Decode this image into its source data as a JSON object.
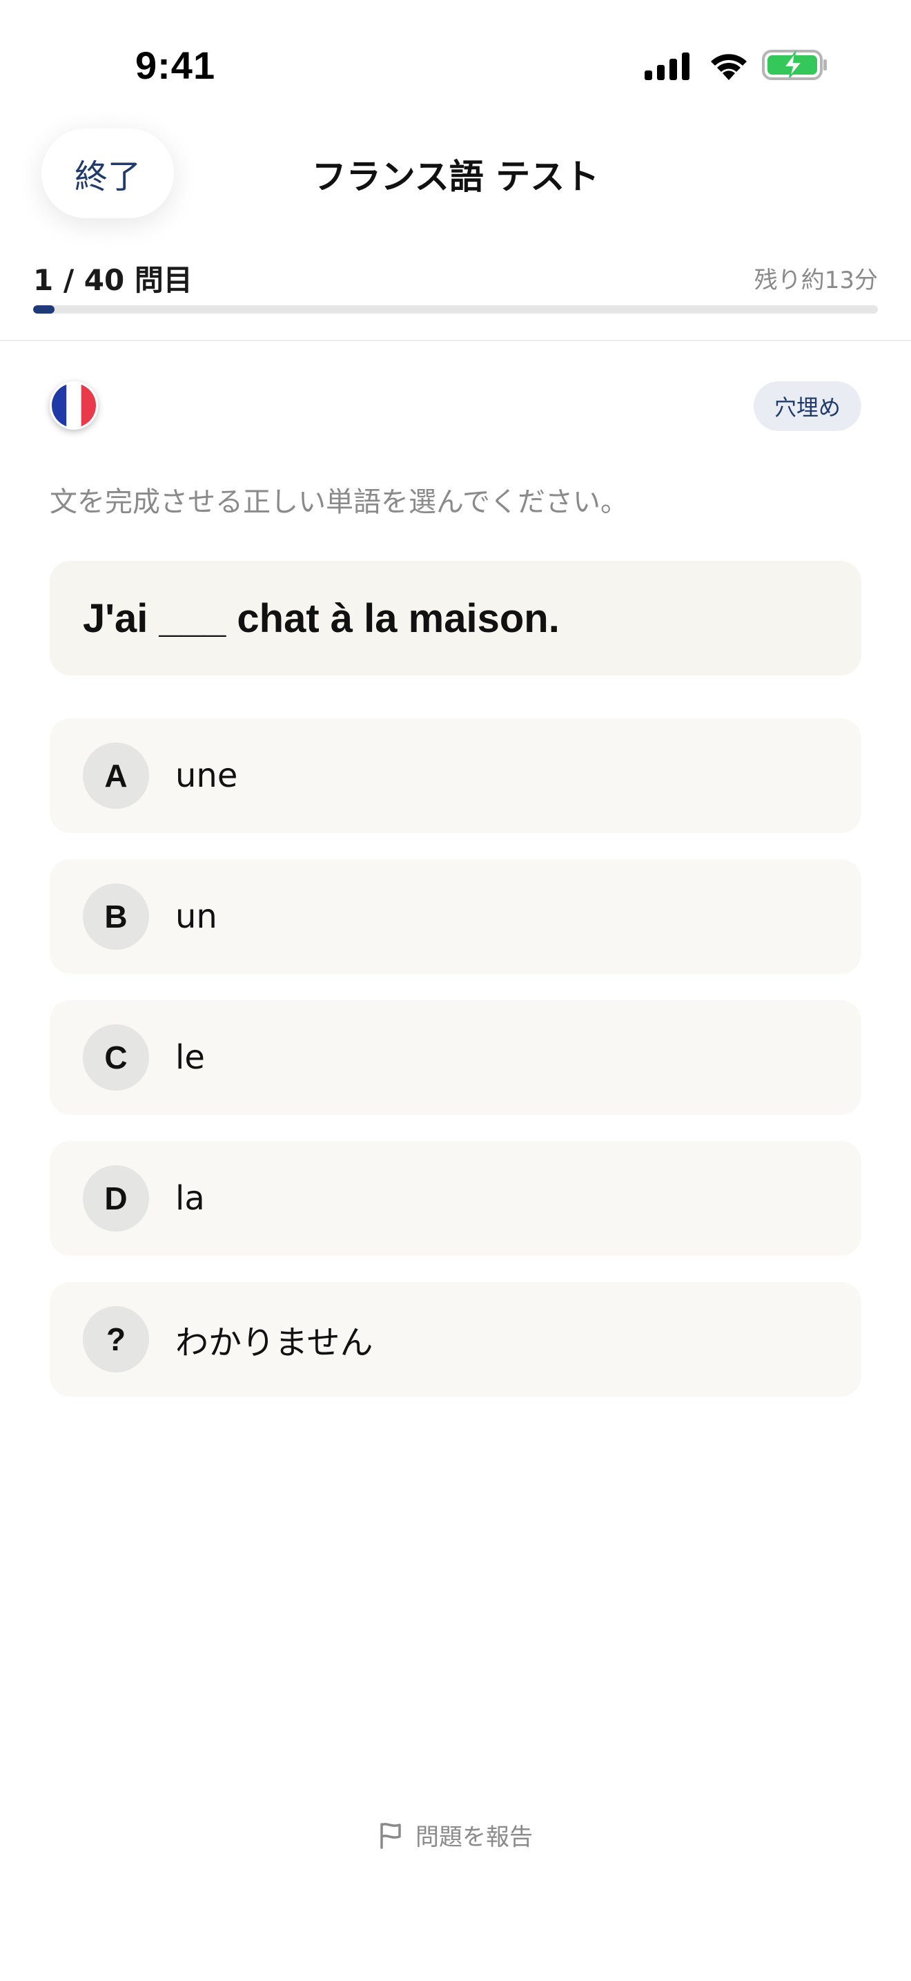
{
  "status_bar": {
    "time": "9:41",
    "icons": [
      "signal-icon",
      "wifi-icon",
      "battery-charging-icon"
    ],
    "battery_color": "#34c759"
  },
  "header": {
    "quit_label": "終了",
    "title": "フランス語 テスト"
  },
  "progress": {
    "count_label": "1 / 40 問目",
    "remaining_label": "残り約13分",
    "current": 1,
    "total": 40,
    "fill_color": "#1e3a78"
  },
  "question": {
    "language_flag": "france-flag-icon",
    "type_badge": "穴埋め",
    "instruction": "文を完成させる正しい単語を選んでください。",
    "sentence": "J'ai ___ chat à la maison."
  },
  "options": [
    {
      "letter": "A",
      "text": "une"
    },
    {
      "letter": "B",
      "text": "un"
    },
    {
      "letter": "C",
      "text": "le"
    },
    {
      "letter": "D",
      "text": "la"
    },
    {
      "letter": "?",
      "text": "わかりません"
    }
  ],
  "footer": {
    "report_label": "問題を報告",
    "report_icon": "flag-icon"
  }
}
